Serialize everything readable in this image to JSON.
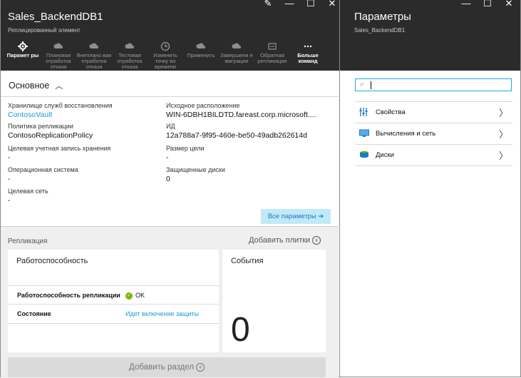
{
  "left": {
    "title": "Sales_BackendDB1",
    "subtitle": "Реплицированный элемент",
    "window_controls": [
      "pin-icon",
      "minimize-icon",
      "maximize-icon",
      "close-icon"
    ],
    "commands": [
      {
        "label": "Парамет ры",
        "icon": "gear-icon",
        "active": true
      },
      {
        "label": "Плановая отработка отказа",
        "icon": "cloud-arrow-icon",
        "active": false
      },
      {
        "label": "Внеплано вая отработка отказа",
        "icon": "cloud-warning-icon",
        "active": false
      },
      {
        "label": "Тестовая отработка отказа",
        "icon": "cloud-check-icon",
        "active": false
      },
      {
        "label": "Изменить точку во времени",
        "icon": "clock-icon",
        "active": false
      },
      {
        "label": "Применить",
        "icon": "cloud-check-icon",
        "active": false
      },
      {
        "label": "Завершени е миграции",
        "icon": "cloud-done-icon",
        "active": false
      },
      {
        "label": "Обратная репликация",
        "icon": "reverse-icon",
        "active": false
      },
      {
        "label": "Больше команд",
        "icon": "more-icon",
        "active": true
      }
    ],
    "essentials": {
      "title": "Основное",
      "vault_label": "Хранилище служб восстановления",
      "vault_value": "ContosoVault",
      "source_label": "Исходное расположение",
      "source_value": "WIN-6DBH1BILDTD.fareast.corp.microsoft....",
      "policy_label": "Политика репликации",
      "policy_value": "ContosoReplicationPolicy",
      "id_label": "ИД",
      "id_value": "12a788a7-9f95-460e-be50-49adb262614d",
      "storage_label": "Целевая учетная запись хранения",
      "storage_value": "-",
      "size_label": "Размер цели",
      "size_value": "-",
      "os_label": "Операционная система",
      "os_value": "-",
      "disks_label": "Защищенные диски",
      "disks_value": "0",
      "network_label": "Целевая сеть",
      "network_value": "-",
      "all_settings": "Все параметры ➔"
    },
    "replication": {
      "title": "Репликация",
      "add_tiles": "Добавить плитки",
      "health_title": "Работоспособность",
      "rows": [
        {
          "key": "Работоспособность репликации",
          "value": "OK"
        },
        {
          "key": "Состояние",
          "value": "Идет включение защиты"
        }
      ],
      "events_title": "События",
      "events_count": "0",
      "add_section": "Добавить раздел"
    }
  },
  "right": {
    "title": "Параметры",
    "subtitle": "Sales_BackendDB1",
    "window_controls": [
      "minimize-icon",
      "maximize-icon",
      "close-icon"
    ],
    "search_placeholder": "",
    "items": [
      {
        "label": "Свойства",
        "icon": "properties-icon"
      },
      {
        "label": "Вычисления и сеть",
        "icon": "compute-network-icon"
      },
      {
        "label": "Диски",
        "icon": "disks-icon"
      }
    ]
  },
  "colors": {
    "header": "#2b2b2b",
    "accent": "#1a9bd8",
    "ok": "#7ab800",
    "button_bg": "#c1e9f8"
  }
}
